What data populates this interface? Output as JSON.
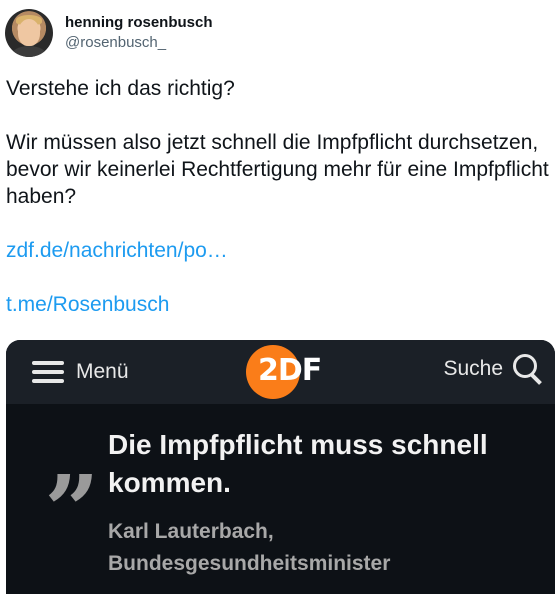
{
  "tweet": {
    "author": {
      "display_name": "henning rosenbusch",
      "handle": "@rosenbusch_"
    },
    "paragraphs": [
      "Verstehe ich das richtig?",
      "Wir müssen also jetzt schnell die Impfpflicht durchsetzen, bevor wir keinerlei Rechtfertigung mehr für eine Impfpflicht haben?"
    ],
    "links": [
      "zdf.de/nachrichten/po…",
      "t.me/Rosenbusch"
    ]
  },
  "media": {
    "nav": {
      "menu_label": "Menü",
      "logo_text": "2DF",
      "search_label": "Suche"
    },
    "quote_mark": "„",
    "quote": "Die Impfpflicht muss schnell kommen.",
    "author_line1": "Karl Lauterbach,",
    "author_line2": "Bundesgesundheitsminister",
    "colors": {
      "logo": "#fa7d19",
      "background": "#0d1116",
      "link": "#1d9bf0"
    }
  }
}
